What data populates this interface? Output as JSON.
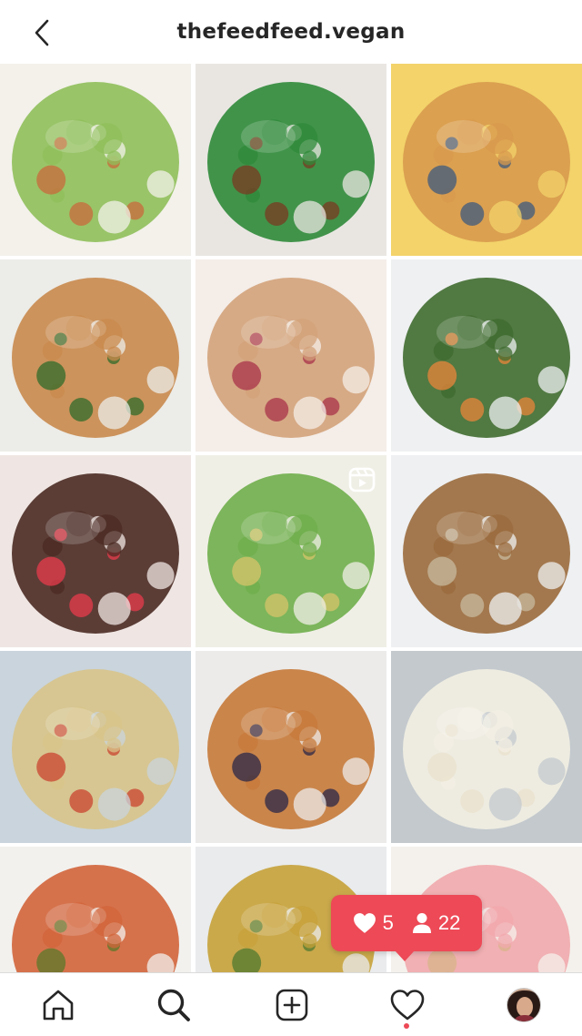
{
  "header": {
    "title": "thefeedfeed.vegan",
    "back_icon": "chevron-left-icon"
  },
  "grid": {
    "tiles": [
      {
        "name": "post-edamame-veggie-bowl",
        "colors": [
          "#8fbf5a",
          "#f3f1ea",
          "#c96a3b"
        ]
      },
      {
        "name": "post-glazed-bok-choy",
        "colors": [
          "#2f8a3a",
          "#e9e6e2",
          "#7a3a22"
        ]
      },
      {
        "name": "post-crispy-breaded-tofu",
        "colors": [
          "#d89a4e",
          "#f3d36a",
          "#3d5a7d"
        ]
      },
      {
        "name": "post-rigatoni-pasta",
        "colors": [
          "#c9894c",
          "#ecece8",
          "#2f6b2a"
        ]
      },
      {
        "name": "post-fig-and-banana-toasts",
        "colors": [
          "#d3a27a",
          "#f4ede8",
          "#a8324a"
        ]
      },
      {
        "name": "post-roasted-veggie-tahini-bowl",
        "colors": [
          "#3f6b2f",
          "#eef0f1",
          "#e9853b"
        ]
      },
      {
        "name": "post-chocolate-raspberry-bars",
        "colors": [
          "#4a2a22",
          "#efe6e3",
          "#e83b4c"
        ]
      },
      {
        "name": "post-chickpea-salad",
        "colors": [
          "#6fae4b",
          "#f0efe6",
          "#d7c46a"
        ]
      },
      {
        "name": "post-seeded-muffins",
        "colors": [
          "#9a6a3c",
          "#eef0f2",
          "#c7ba9f"
        ]
      },
      {
        "name": "post-shell-pasta-salad",
        "colors": [
          "#d8c48a",
          "#c9d4dc",
          "#c9432f"
        ]
      },
      {
        "name": "post-banana-blueberry-toasts",
        "colors": [
          "#c77a3a",
          "#ecebea",
          "#2a2747"
        ]
      },
      {
        "name": "post-coconut-cake",
        "colors": [
          "#f3efe3",
          "#c3c9cd",
          "#e9e2cc"
        ]
      },
      {
        "name": "post-hummus-grazing-platter",
        "colors": [
          "#d2643a",
          "#f2f1ee",
          "#5a7a2a"
        ]
      },
      {
        "name": "post-asparagus-omelette",
        "colors": [
          "#c7a23a",
          "#e9ebec",
          "#4f7a2f"
        ]
      },
      {
        "name": "post-pink-frosted-cookies",
        "colors": [
          "#f1a8ad",
          "#f4f1ec",
          "#d7b48a"
        ]
      }
    ],
    "reel_icon": "reel-icon"
  },
  "activity": {
    "likes_icon": "heart-icon",
    "likes_count": "5",
    "followers_icon": "person-icon",
    "followers_count": "22"
  },
  "bottom_nav": {
    "items": [
      "home-icon",
      "search-icon",
      "new-post-icon",
      "activity-heart-icon",
      "profile-avatar"
    ]
  }
}
